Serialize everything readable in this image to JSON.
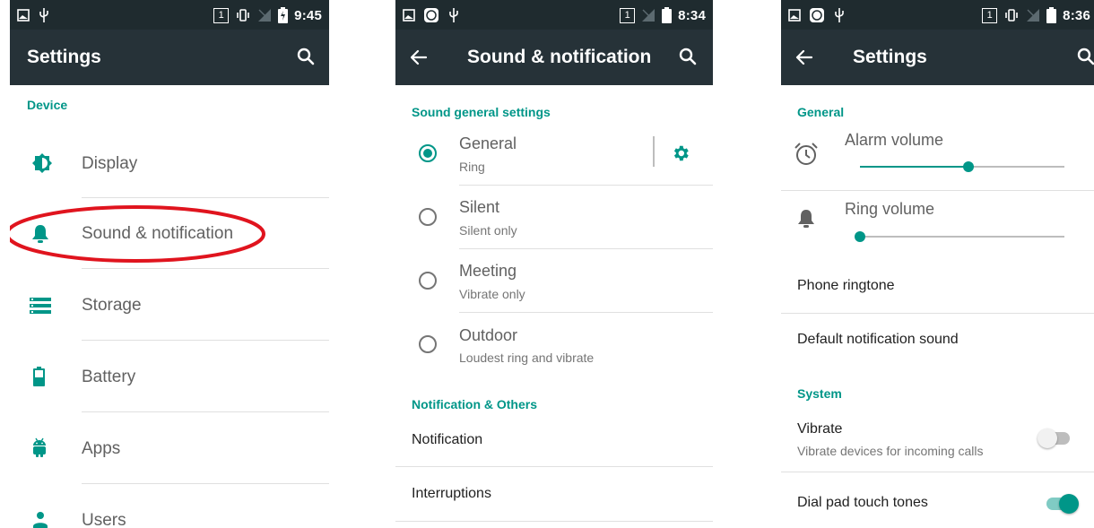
{
  "colors": {
    "accent": "#009688",
    "statusbar": "#1f2b2f",
    "appbar": "#263238",
    "highlight": "#e0141e"
  },
  "screen1": {
    "status": {
      "time": "9:45",
      "sim": "1",
      "icons": [
        "image-icon",
        "usb-icon",
        "vibrate-icon",
        "no-signal-icon",
        "battery-charging-icon"
      ]
    },
    "title": "Settings",
    "section": "Device",
    "items": [
      {
        "label": "Display",
        "icon": "brightness-icon"
      },
      {
        "label": "Sound & notification",
        "icon": "bell-icon"
      },
      {
        "label": "Storage",
        "icon": "storage-icon"
      },
      {
        "label": "Battery",
        "icon": "battery-icon"
      },
      {
        "label": "Apps",
        "icon": "android-icon"
      },
      {
        "label": "Users",
        "icon": "person-icon"
      }
    ]
  },
  "screen2": {
    "status": {
      "time": "8:34",
      "sim": "1",
      "icons": [
        "image-icon",
        "app-badge-icon",
        "usb-icon",
        "no-signal-icon",
        "battery-icon"
      ]
    },
    "title": "Sound & notification",
    "section_general": "Sound general settings",
    "profiles": [
      {
        "title": "General",
        "subtitle": "Ring",
        "selected": true
      },
      {
        "title": "Silent",
        "subtitle": "Silent only",
        "selected": false
      },
      {
        "title": "Meeting",
        "subtitle": "Vibrate only",
        "selected": false
      },
      {
        "title": "Outdoor",
        "subtitle": "Loudest ring and vibrate",
        "selected": false
      }
    ],
    "section_other": "Notification & Others",
    "items": [
      {
        "label": "Notification"
      },
      {
        "label": "Interruptions"
      }
    ]
  },
  "screen3": {
    "status": {
      "time": "8:36",
      "sim": "1",
      "icons": [
        "image-icon",
        "app-badge-icon",
        "usb-icon",
        "vibrate-icon",
        "no-signal-icon",
        "battery-icon"
      ]
    },
    "title": "Settings",
    "section_general": "General",
    "alarm": {
      "label": "Alarm volume",
      "level": 0.53
    },
    "ring": {
      "label": "Ring volume",
      "level": 0.0
    },
    "phone_ringtone": "Phone ringtone",
    "default_notification": "Default notification sound",
    "section_system": "System",
    "vibrate": {
      "title": "Vibrate",
      "subtitle": "Vibrate devices for incoming calls",
      "on": false
    },
    "dialpad": {
      "label": "Dial pad touch tones",
      "on": true
    }
  }
}
